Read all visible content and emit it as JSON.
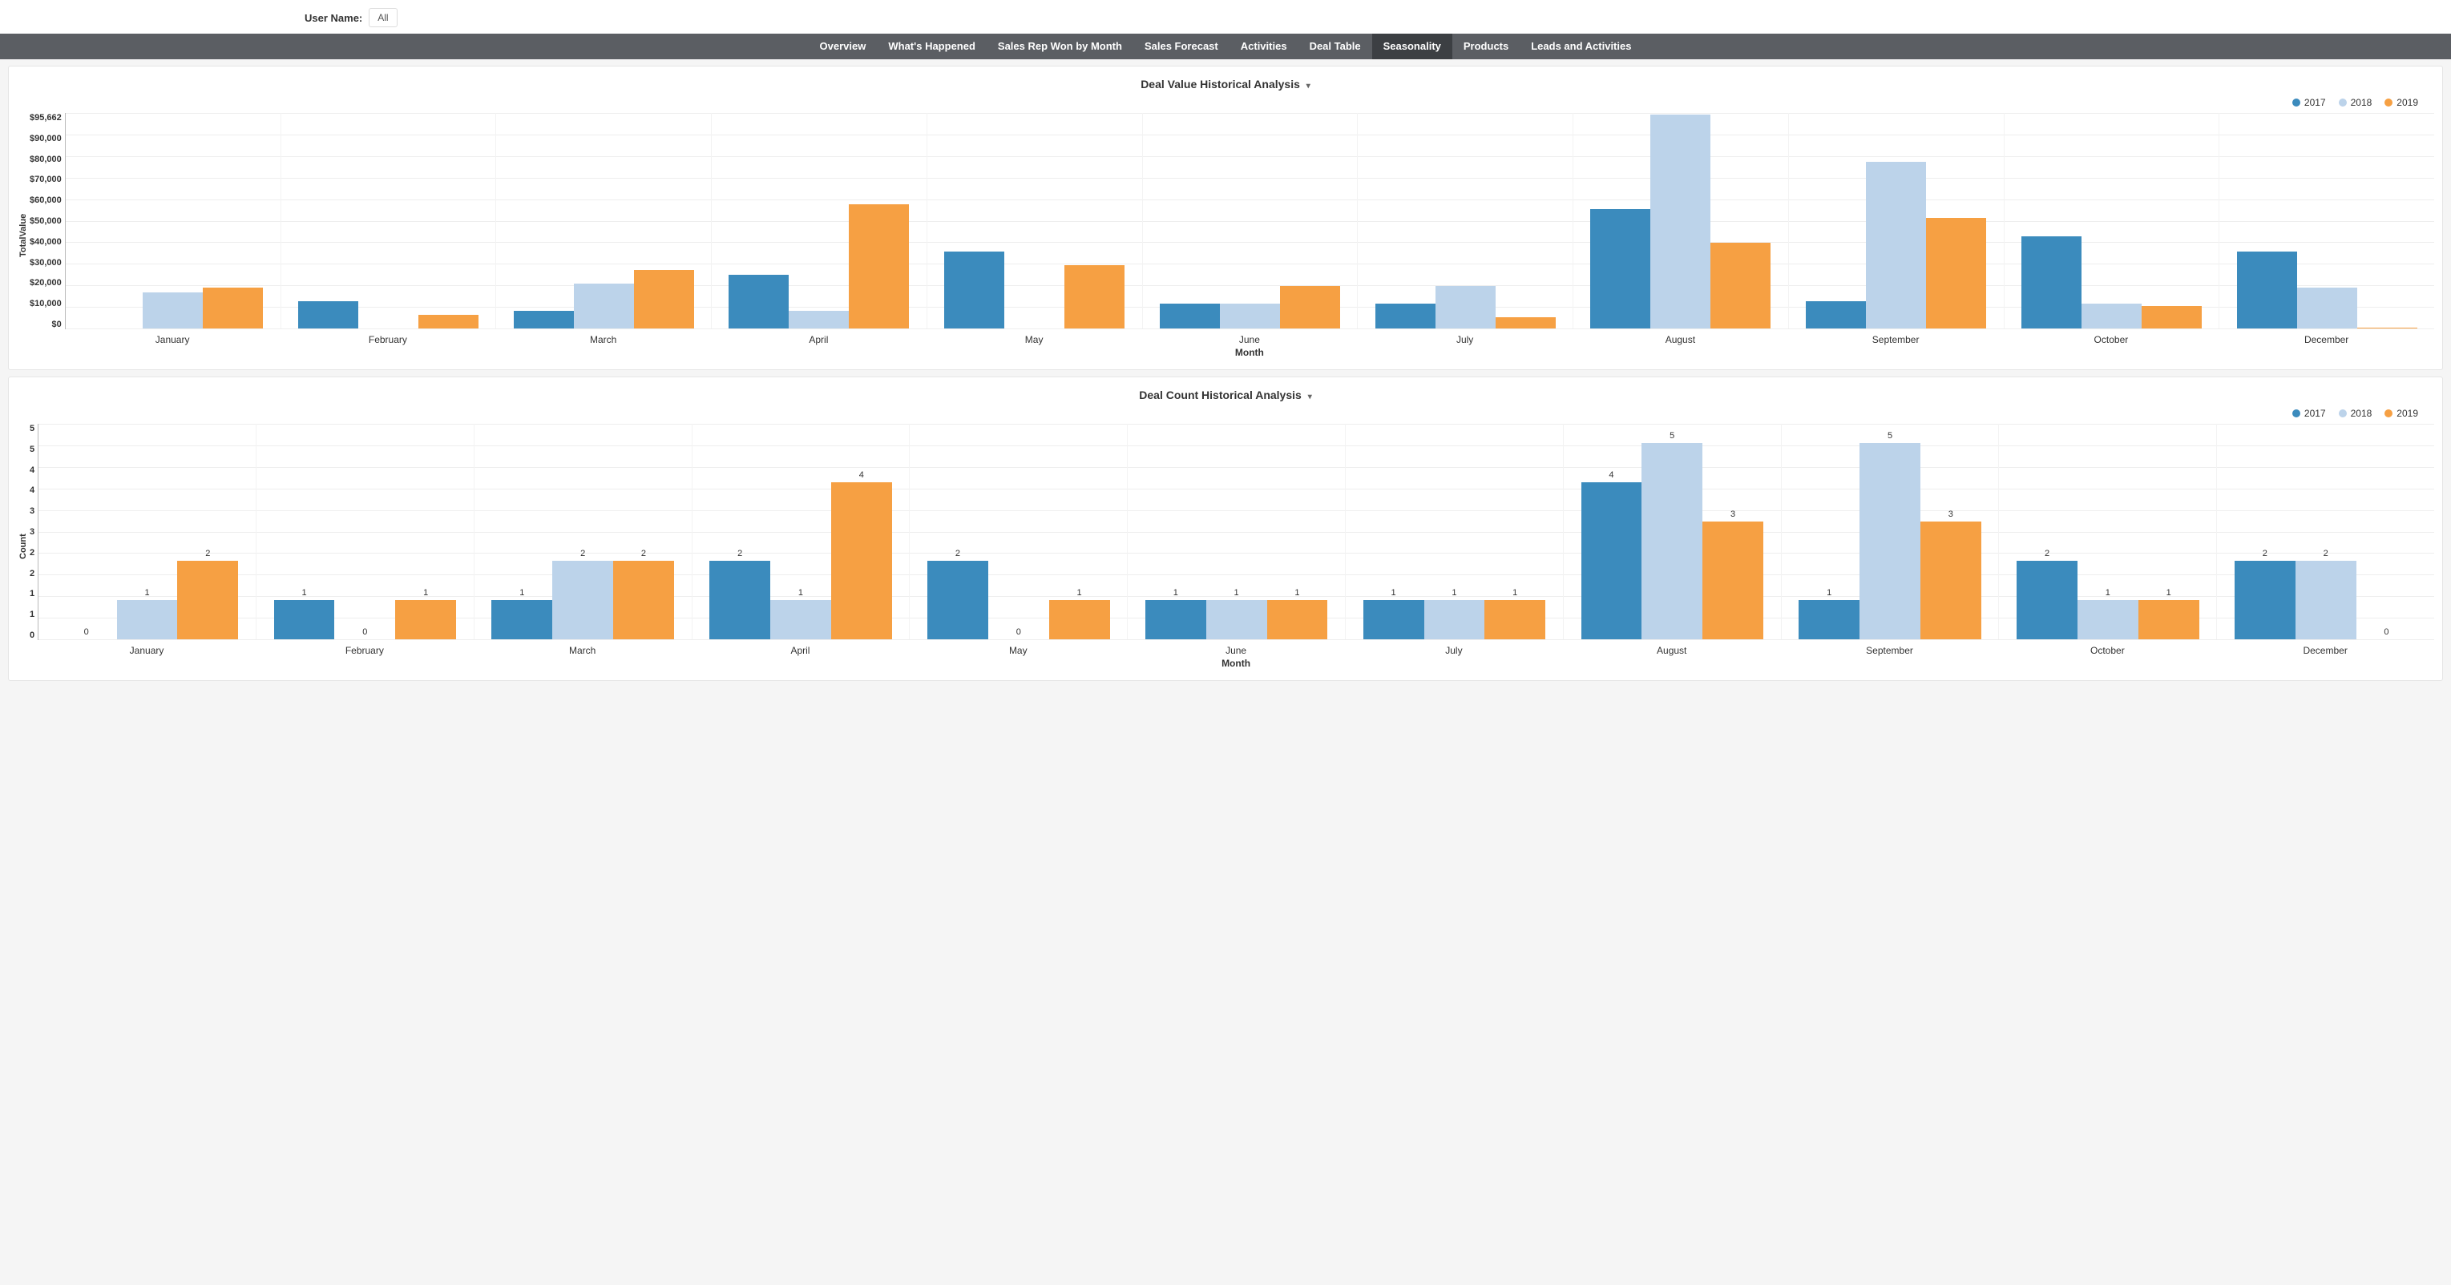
{
  "filter": {
    "label": "User Name:",
    "value": "All"
  },
  "nav": {
    "items": [
      "Overview",
      "What's Happened",
      "Sales Rep Won by Month",
      "Sales Forecast",
      "Activities",
      "Deal Table",
      "Seasonality",
      "Products",
      "Leads and Activities"
    ],
    "active": "Seasonality"
  },
  "panel1": {
    "title": "Deal Value Historical Analysis"
  },
  "panel2": {
    "title": "Deal Count Historical Analysis"
  },
  "legend": {
    "a": "2017",
    "b": "2018",
    "c": "2019"
  },
  "axis": {
    "month": "Month",
    "totalvalue": "TotalValue",
    "count": "Count"
  },
  "chart_data": [
    {
      "type": "bar",
      "title": "Deal Value Historical Analysis",
      "xlabel": "Month",
      "ylabel": "TotalValue",
      "ylim": [
        0,
        95662
      ],
      "y_ticks": [
        "$95,662",
        "$90,000",
        "$80,000",
        "$70,000",
        "$60,000",
        "$50,000",
        "$40,000",
        "$30,000",
        "$20,000",
        "$10,000",
        "$0"
      ],
      "categories": [
        "January",
        "February",
        "March",
        "April",
        "May",
        "June",
        "July",
        "August",
        "September",
        "October",
        "December"
      ],
      "series": [
        {
          "name": "2017",
          "color": "#3b8bbd",
          "values": [
            0,
            12000,
            8000,
            24000,
            34000,
            11000,
            11000,
            53000,
            12000,
            41000,
            34000
          ]
        },
        {
          "name": "2018",
          "color": "#bcd3ea",
          "values": [
            16000,
            0,
            20000,
            8000,
            0,
            11000,
            19000,
            95000,
            74000,
            11000,
            18000
          ]
        },
        {
          "name": "2019",
          "color": "#f6a043",
          "values": [
            18000,
            6000,
            26000,
            55000,
            28000,
            19000,
            5000,
            38000,
            49000,
            10000,
            500
          ]
        }
      ],
      "legend_position": "top-right"
    },
    {
      "type": "bar",
      "title": "Deal Count Historical Analysis",
      "xlabel": "Month",
      "ylabel": "Count",
      "ylim": [
        0,
        5.5
      ],
      "y_ticks": [
        "5",
        "5",
        "4",
        "4",
        "3",
        "3",
        "2",
        "2",
        "1",
        "1",
        "0"
      ],
      "categories": [
        "January",
        "February",
        "March",
        "April",
        "May",
        "June",
        "July",
        "August",
        "September",
        "October",
        "December"
      ],
      "series": [
        {
          "name": "2017",
          "color": "#3b8bbd",
          "values": [
            0,
            1,
            1,
            2,
            2,
            1,
            1,
            4,
            1,
            2,
            2
          ]
        },
        {
          "name": "2018",
          "color": "#bcd3ea",
          "values": [
            1,
            0,
            2,
            1,
            0,
            1,
            1,
            5,
            5,
            1,
            2
          ]
        },
        {
          "name": "2019",
          "color": "#f6a043",
          "values": [
            2,
            1,
            2,
            4,
            1,
            1,
            1,
            3,
            3,
            1,
            0
          ]
        }
      ],
      "show_data_labels": true,
      "legend_position": "top-right"
    }
  ]
}
